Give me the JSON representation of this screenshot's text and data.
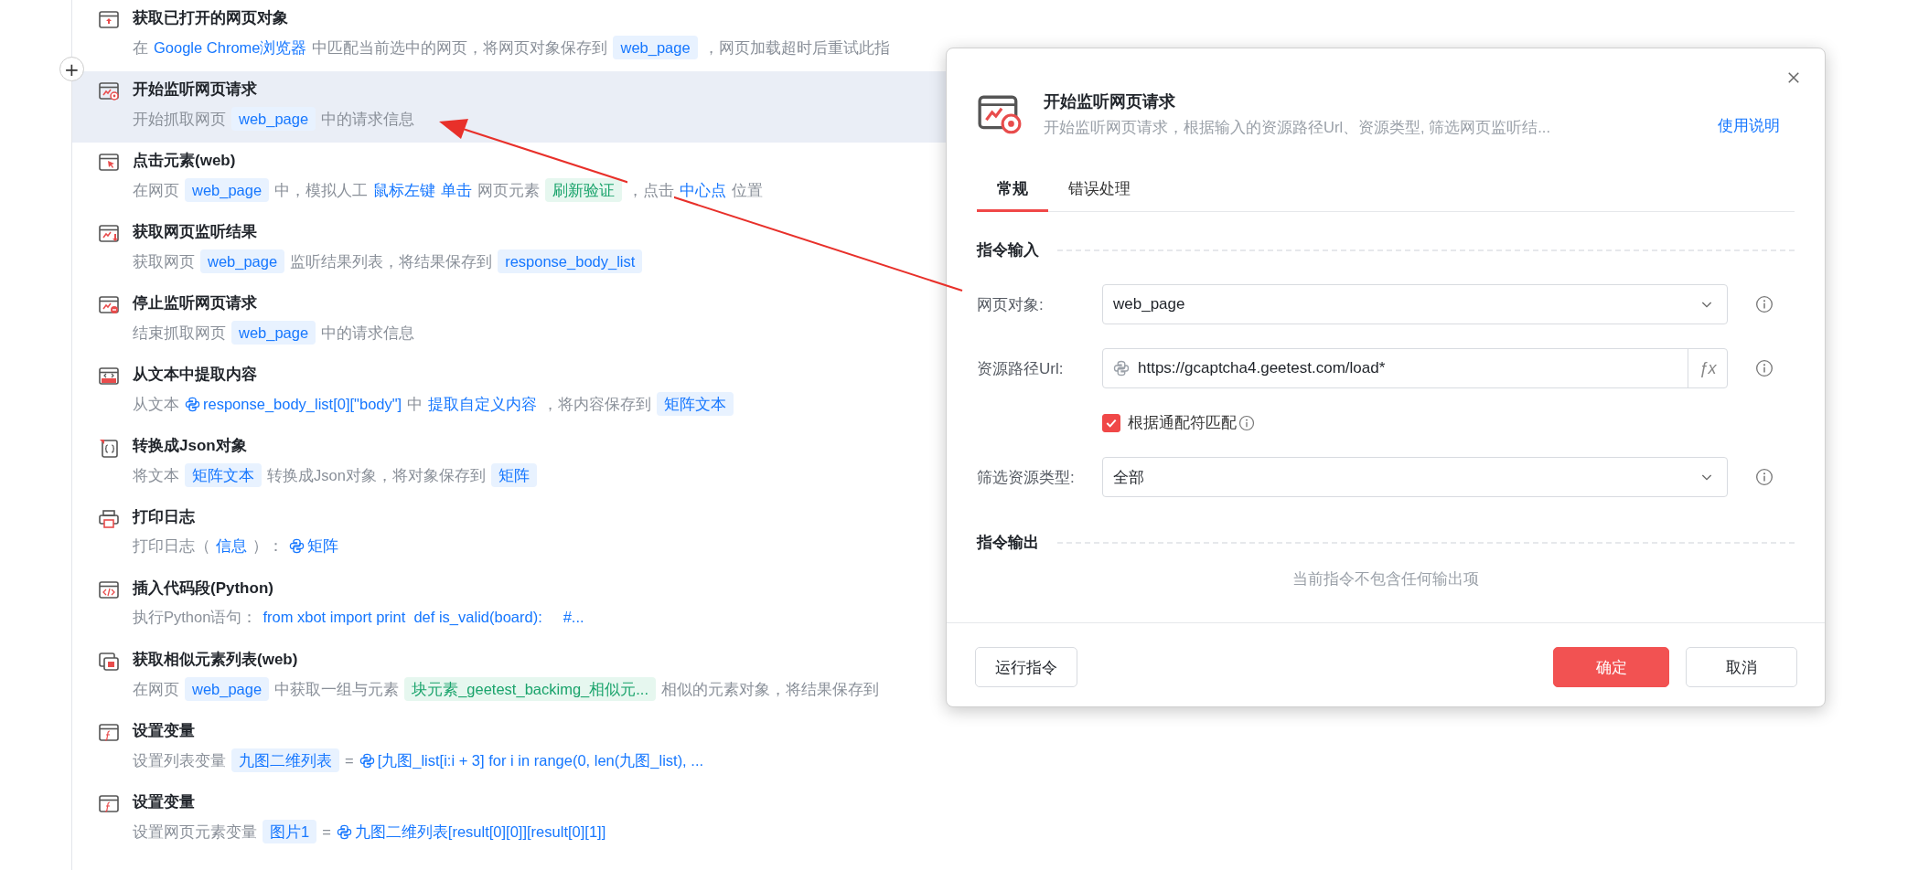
{
  "steps": [
    {
      "title": "获取已打开的网页对象",
      "selected": false,
      "desc": [
        {
          "kind": "text",
          "text": "在"
        },
        {
          "kind": "link",
          "text": "Google Chrome浏览器"
        },
        {
          "kind": "text",
          "text": "中匹配当前选中的网页，将网页对象保存到"
        },
        {
          "kind": "var",
          "text": "web_page"
        },
        {
          "kind": "text",
          "text": "，网页加载超时后重试此指"
        }
      ]
    },
    {
      "title": "开始监听网页请求",
      "selected": true,
      "desc": [
        {
          "kind": "text",
          "text": "开始抓取网页"
        },
        {
          "kind": "var",
          "text": "web_page"
        },
        {
          "kind": "text",
          "text": "中的请求信息"
        }
      ]
    },
    {
      "title": "点击元素(web)",
      "selected": false,
      "desc": [
        {
          "kind": "text",
          "text": "在网页"
        },
        {
          "kind": "var",
          "text": "web_page"
        },
        {
          "kind": "text",
          "text": "中，模拟人工"
        },
        {
          "kind": "link",
          "text": "鼠标左键"
        },
        {
          "kind": "link",
          "text": "单击"
        },
        {
          "kind": "text",
          "text": "网页元素"
        },
        {
          "kind": "element",
          "text": "刷新验证"
        },
        {
          "kind": "text",
          "text": "，点击"
        },
        {
          "kind": "link",
          "text": "中心点"
        },
        {
          "kind": "text",
          "text": "位置"
        }
      ]
    },
    {
      "title": "获取网页监听结果",
      "selected": false,
      "desc": [
        {
          "kind": "text",
          "text": "获取网页"
        },
        {
          "kind": "var",
          "text": "web_page"
        },
        {
          "kind": "text",
          "text": "监听结果列表，将结果保存到"
        },
        {
          "kind": "var",
          "text": "response_body_list"
        }
      ]
    },
    {
      "title": "停止监听网页请求",
      "selected": false,
      "desc": [
        {
          "kind": "text",
          "text": "结束抓取网页"
        },
        {
          "kind": "var",
          "text": "web_page"
        },
        {
          "kind": "text",
          "text": "中的请求信息"
        }
      ]
    },
    {
      "title": "从文本中提取内容",
      "selected": false,
      "desc": [
        {
          "kind": "text",
          "text": "从文本"
        },
        {
          "kind": "python",
          "text": "response_body_list[0][\"body\"]"
        },
        {
          "kind": "text",
          "text": "中"
        },
        {
          "kind": "link",
          "text": "提取自定义内容"
        },
        {
          "kind": "text",
          "text": "，将内容保存到"
        },
        {
          "kind": "var",
          "text": "矩阵文本"
        }
      ]
    },
    {
      "title": "转换成Json对象",
      "selected": false,
      "desc": [
        {
          "kind": "text",
          "text": "将文本"
        },
        {
          "kind": "var",
          "text": "矩阵文本"
        },
        {
          "kind": "text",
          "text": "转换成Json对象，将对象保存到"
        },
        {
          "kind": "var",
          "text": "矩阵"
        }
      ]
    },
    {
      "title": "打印日志",
      "selected": false,
      "desc": [
        {
          "kind": "text",
          "text": "打印日志（"
        },
        {
          "kind": "link",
          "text": "信息"
        },
        {
          "kind": "text",
          "text": "）："
        },
        {
          "kind": "python",
          "text": "矩阵"
        }
      ]
    },
    {
      "title": "插入代码段(Python)",
      "selected": false,
      "desc": [
        {
          "kind": "text",
          "text": "执行Python语句："
        },
        {
          "kind": "link",
          "text": "from xbot import print  def is_valid(board):     #..."
        }
      ]
    },
    {
      "title": "获取相似元素列表(web)",
      "selected": false,
      "desc": [
        {
          "kind": "text",
          "text": "在网页"
        },
        {
          "kind": "var",
          "text": "web_page"
        },
        {
          "kind": "text",
          "text": "中获取一组与元素"
        },
        {
          "kind": "element",
          "text": "块元素_geetest_backimg_相似元..."
        },
        {
          "kind": "text",
          "text": "相似的元素对象，将结果保存到"
        }
      ]
    },
    {
      "title": "设置变量",
      "selected": false,
      "desc": [
        {
          "kind": "text",
          "text": "设置列表变量"
        },
        {
          "kind": "var",
          "text": "九图二维列表"
        },
        {
          "kind": "text",
          "text": "="
        },
        {
          "kind": "python",
          "text": "[九图_list[i:i + 3] for i in range(0, len(九图_list), ..."
        }
      ]
    },
    {
      "title": "设置变量",
      "selected": false,
      "desc": [
        {
          "kind": "text",
          "text": "设置网页元素变量"
        },
        {
          "kind": "var",
          "text": "图片1"
        },
        {
          "kind": "text",
          "text": "="
        },
        {
          "kind": "python",
          "text": "九图二维列表[result[0][0]][result[0][1]]"
        }
      ]
    }
  ],
  "add_button": "+",
  "dialog": {
    "title": "开始监听网页请求",
    "subtitle": "开始监听网页请求，根据输入的资源路径Url、资源类型, 筛选网页监听结...",
    "help_link": "使用说明",
    "tabs": [
      {
        "label": "常规",
        "selected": true
      },
      {
        "label": "错误处理",
        "selected": false
      }
    ],
    "input_section": "指令输入",
    "fields": [
      {
        "kind": "select",
        "label": "网页对象:",
        "value": "web_page"
      },
      {
        "kind": "expression",
        "label": "资源路径Url:",
        "value": "https://gcaptcha4.geetest.com/load*",
        "fx": "ƒx"
      },
      {
        "kind": "checkbox",
        "label": "根据通配符匹配",
        "checked": true
      },
      {
        "kind": "select",
        "label": "筛选资源类型:",
        "value": "全部"
      }
    ],
    "output_section": "指令输出",
    "output_empty": "当前指令不包含任何输出项",
    "buttons": [
      {
        "label": "运行指令",
        "kind": "default"
      },
      {
        "label": "确定",
        "kind": "primary"
      },
      {
        "label": "取消",
        "kind": "default"
      }
    ]
  }
}
